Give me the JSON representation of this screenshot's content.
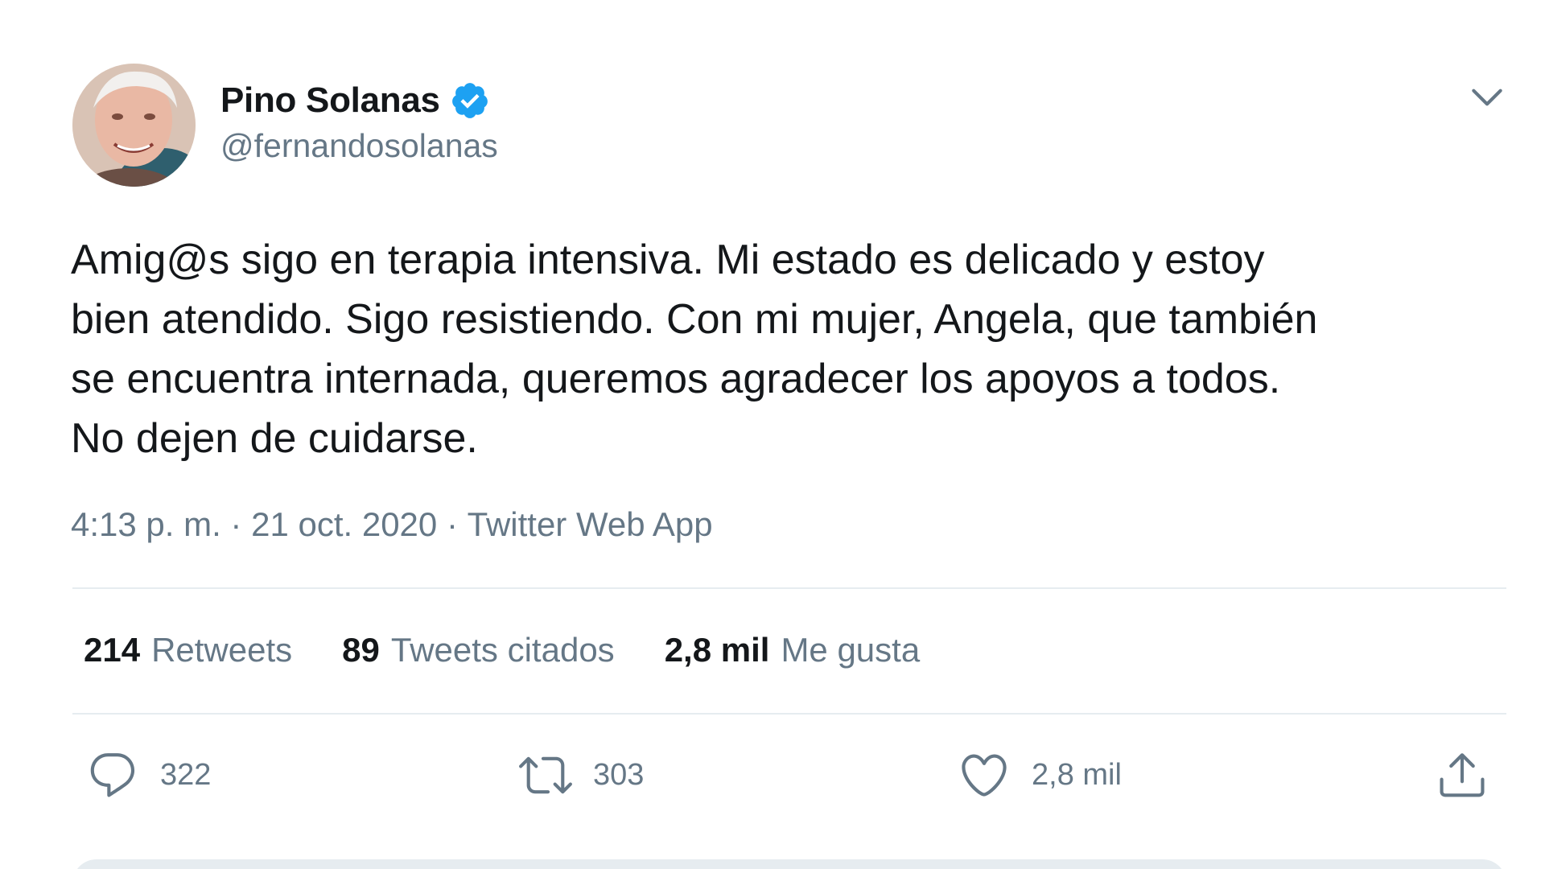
{
  "user": {
    "display_name": "Pino Solanas",
    "handle": "@fernandosolanas",
    "verified": true
  },
  "tweet": {
    "lines": [
      "Amig@s sigo en terapia intensiva. Mi estado es delicado y estoy",
      "bien atendido. Sigo resistiendo. Con mi mujer, Angela, que también",
      "se encuentra internada, queremos agradecer los apoyos a todos.",
      "No dejen de cuidarse."
    ],
    "time": "4:13 p. m.",
    "separator": " · ",
    "date": "21 oct. 2020",
    "source": "Twitter Web App"
  },
  "stats": {
    "retweets": {
      "num": "214",
      "label": "Retweets"
    },
    "quotes": {
      "num": "89",
      "label": "Tweets citados"
    },
    "likes": {
      "num": "2,8 mil",
      "label": "Me gusta"
    }
  },
  "actions": {
    "reply_count": "322",
    "retweet_count": "303",
    "like_count": "2,8 mil"
  },
  "icons": {
    "verified": "verified-badge-icon",
    "caret": "chevron-down-icon",
    "reply": "reply-icon",
    "retweet": "retweet-icon",
    "like": "heart-icon",
    "share": "share-icon"
  },
  "colors": {
    "verified_blue": "#1da1f2",
    "text_primary": "#14171a",
    "text_secondary": "#657786",
    "divider": "#e6ecf0"
  }
}
